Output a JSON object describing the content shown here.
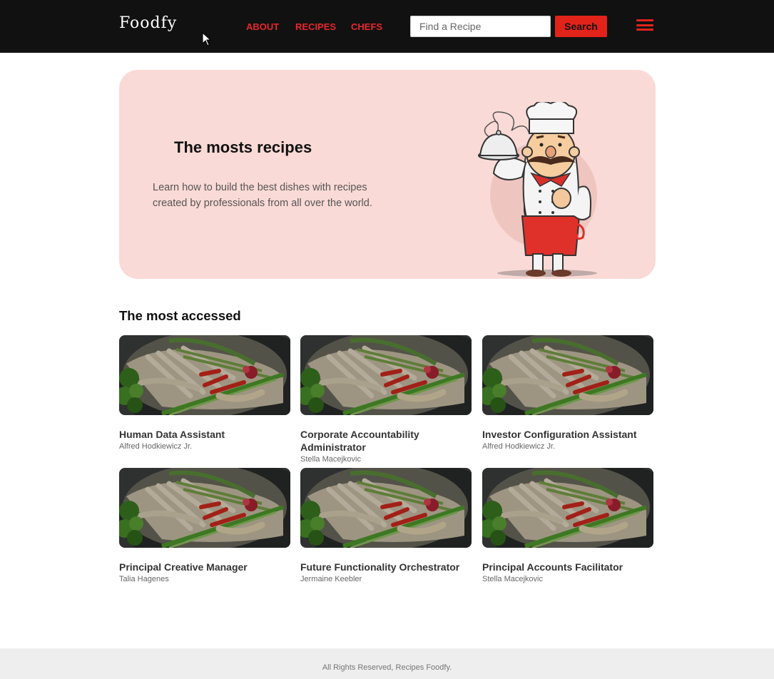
{
  "header": {
    "logo": "Foodfy",
    "nav": [
      {
        "label": "ABOUT"
      },
      {
        "label": "RECIPES"
      },
      {
        "label": "CHEFS"
      }
    ],
    "search": {
      "placeholder": "Find a Recipe",
      "value": "",
      "button_label": "Search"
    },
    "menu_icon": "hamburger-menu-icon"
  },
  "hero": {
    "title": "The mosts recipes",
    "description": "Learn how to build the best dishes with recipes created by professionals from all over the world.",
    "illustration": "chef-illustration"
  },
  "section": {
    "title": "The most accessed"
  },
  "recipes": [
    {
      "title": "Human Data Assistant",
      "author": "Alfred Hodkiewicz Jr."
    },
    {
      "title": "Corporate Accountability Administrator",
      "author": "Stella Macejkovic"
    },
    {
      "title": "Investor Configuration Assistant",
      "author": "Alfred Hodkiewicz Jr."
    },
    {
      "title": "Principal Creative Manager",
      "author": "Talia Hagenes"
    },
    {
      "title": "Future Functionality Orchestrator",
      "author": "Jermaine Keebler"
    },
    {
      "title": "Principal Accounts Facilitator",
      "author": "Stella Macejkovic"
    }
  ],
  "footer": {
    "text": "All Rights Reserved, Recipes Foodfy."
  },
  "colors": {
    "accent": "#e2231a",
    "header_bg": "#111111",
    "hero_bg": "#fadad6",
    "footer_bg": "#eeeeee"
  }
}
